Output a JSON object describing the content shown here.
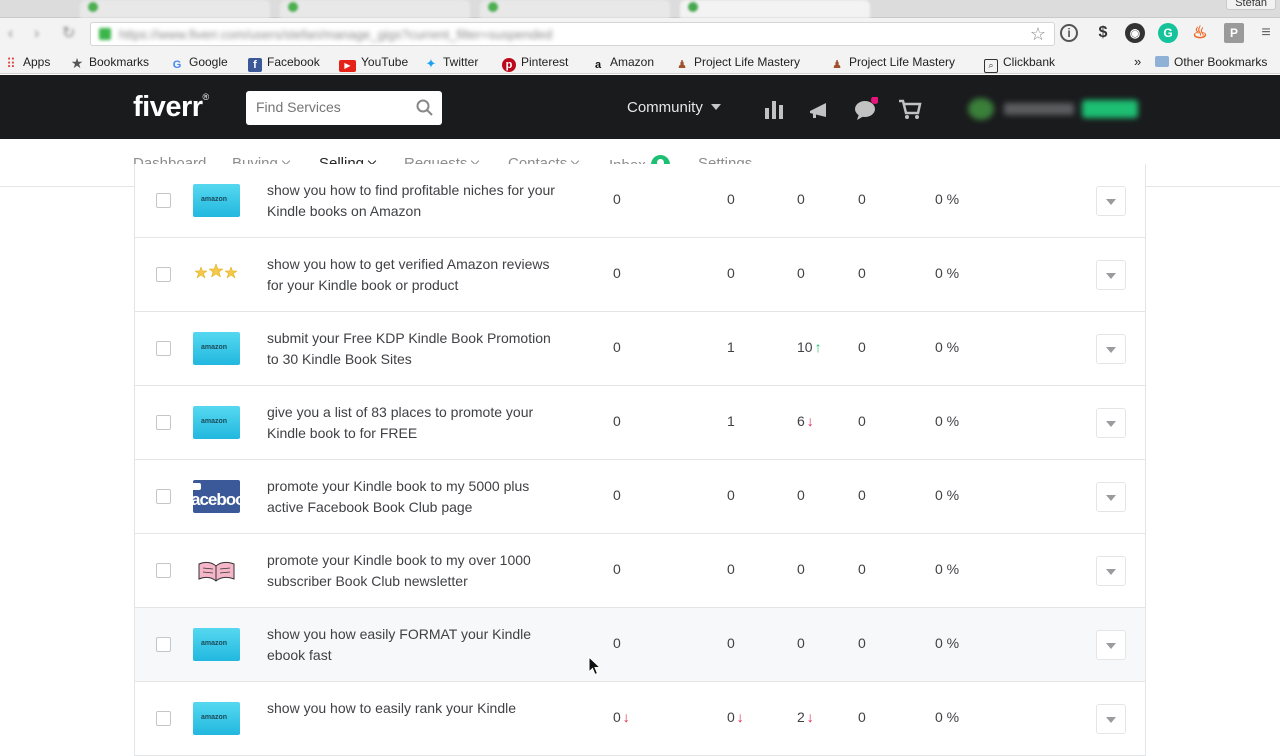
{
  "browser": {
    "user_name": "Stefan",
    "bookmarks": [
      {
        "label": "Apps",
        "icon": "apps-grid-icon"
      },
      {
        "label": "Bookmarks",
        "icon": "star-icon"
      },
      {
        "label": "Google",
        "icon": "google-icon"
      },
      {
        "label": "Facebook",
        "icon": "facebook-icon"
      },
      {
        "label": "YouTube",
        "icon": "youtube-icon"
      },
      {
        "label": "Twitter",
        "icon": "twitter-icon"
      },
      {
        "label": "Pinterest",
        "icon": "pinterest-icon"
      },
      {
        "label": "Amazon",
        "icon": "amazon-icon"
      },
      {
        "label": "Project Life Mastery",
        "icon": "plm-icon"
      },
      {
        "label": "Project Life Mastery",
        "icon": "plm-icon"
      },
      {
        "label": "Clickbank",
        "icon": "clickbank-icon"
      }
    ],
    "overflow": "»",
    "other_bookmarks": "Other Bookmarks"
  },
  "header": {
    "logo": "fiverr",
    "logo_mark": "®",
    "search_placeholder": "Find Services",
    "community": "Community"
  },
  "subnav": {
    "dashboard": "Dashboard",
    "buying": "Buying",
    "selling": "Selling",
    "requests": "Requests",
    "contacts": "Contacts",
    "inbox": "Inbox",
    "settings": "Settings"
  },
  "colors": {
    "header_bg": "#1a1b1d",
    "accent_green": "#1dbf73",
    "trend_up": "#1dbf73",
    "trend_down": "#e0224a"
  },
  "gigs": [
    {
      "title": "show you how to find profitable niches for your Kindle books on Amazon",
      "thumb": "amazon",
      "c1": "0",
      "c2": "0",
      "c3": "0",
      "c4": "0",
      "c5": "0 %",
      "trend": ""
    },
    {
      "title": "show you how to get verified Amazon reviews for your Kindle book or product",
      "thumb": "stars",
      "c1": "0",
      "c2": "0",
      "c3": "0",
      "c4": "0",
      "c5": "0 %",
      "trend": ""
    },
    {
      "title": "submit your Free KDP Kindle Book Promotion to 30 Kindle Book Sites",
      "thumb": "amazon",
      "c1": "0",
      "c2": "1",
      "c3": "10",
      "c4": "0",
      "c5": "0 %",
      "trend": "up"
    },
    {
      "title": "give you a list of 83 places to promote your Kindle book to for FREE",
      "thumb": "amazon",
      "c1": "0",
      "c2": "1",
      "c3": "6",
      "c4": "0",
      "c5": "0 %",
      "trend": "down"
    },
    {
      "title": "promote your Kindle book to my 5000 plus active Facebook Book Club page",
      "thumb": "facebook",
      "c1": "0",
      "c2": "0",
      "c3": "0",
      "c4": "0",
      "c5": "0 %",
      "trend": ""
    },
    {
      "title": "promote your Kindle book to my over 1000 subscriber Book Club newsletter",
      "thumb": "bookclub",
      "c1": "0",
      "c2": "0",
      "c3": "0",
      "c4": "0",
      "c5": "0 %",
      "trend": ""
    },
    {
      "title": "show you how easily FORMAT your Kindle ebook fast",
      "thumb": "amazon",
      "c1": "0",
      "c2": "0",
      "c3": "0",
      "c4": "0",
      "c5": "0 %",
      "trend": "",
      "hover": true
    },
    {
      "title": "show you how to easily rank your Kindle",
      "thumb": "amazon",
      "c1": "0",
      "c2": "0",
      "c3": "2",
      "c4": "0",
      "c5": "0 %",
      "trend": "down",
      "c1_trend": "down",
      "c2_trend": "down"
    }
  ]
}
